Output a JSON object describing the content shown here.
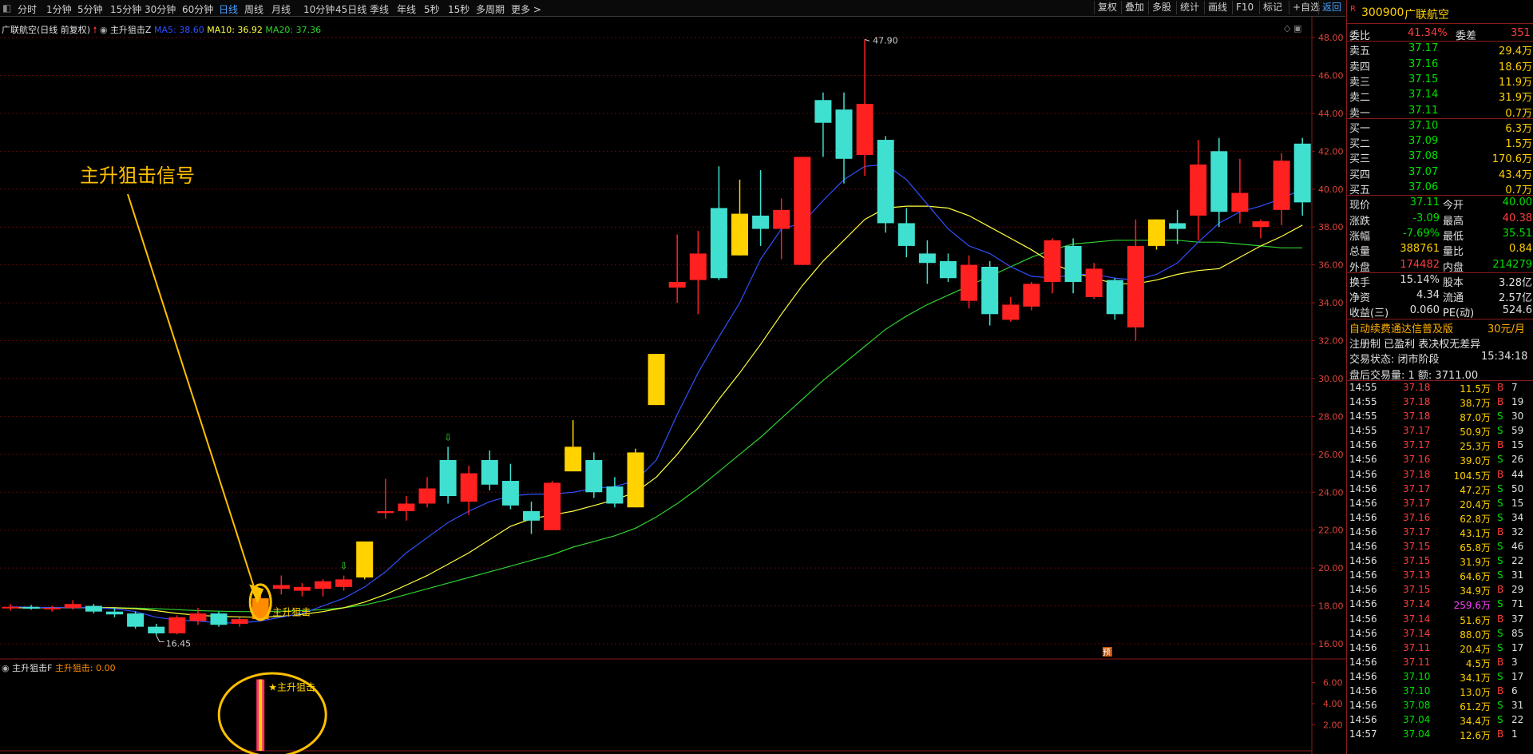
{
  "timeframes": [
    "分时",
    "1分钟",
    "5分钟",
    "15分钟",
    "30分钟",
    "60分钟",
    "日线",
    "周线",
    "月线",
    "10分钟",
    "45日线",
    "季线",
    "年线",
    "5秒",
    "15秒",
    "多周期",
    "更多 >"
  ],
  "active_timeframe": "日线",
  "toolbar_buttons": [
    "复权",
    "叠加",
    "多股",
    "统计",
    "画线",
    "F10",
    "标记",
    "+自选",
    "返回"
  ],
  "chart_header": {
    "stock_label": "广联航空(日线 前复权)",
    "indicator_name": "主升狙击Z",
    "ma5": "MA5: 38.60",
    "ma10": "MA10: 36.92",
    "ma20": "MA20: 37.36"
  },
  "annotation_text": "主升狙击信号",
  "signal_label": "主升狙击",
  "high_label": "47.90",
  "low_label": "16.45",
  "pre_marker": "预",
  "sub_header": {
    "name": "主升狙击F",
    "value": "主升狙击: 0.00"
  },
  "sub_signal_label": "主升狙击",
  "y_axis_main": [
    "48.00",
    "46.00",
    "44.00",
    "42.00",
    "40.00",
    "38.00",
    "36.00",
    "34.00",
    "32.00",
    "30.00",
    "28.00",
    "26.00",
    "24.00",
    "22.00",
    "20.00",
    "18.00",
    "16.00"
  ],
  "y_axis_sub": [
    "6.00",
    "4.00",
    "2.00"
  ],
  "colors": {
    "up": "#ff2020",
    "down": "#40e0d0",
    "limit_up": "#ffd200",
    "signal": "#ff8c00",
    "ma5": "#3050ff",
    "ma10": "#ffff40",
    "ma20": "#30d030"
  },
  "chart_data": {
    "type": "candlestick",
    "ylim": [
      15,
      48.5
    ],
    "candles": [
      {
        "o": 17.9,
        "h": 18.1,
        "l": 17.75,
        "c": 17.95
      },
      {
        "o": 17.95,
        "h": 18.05,
        "l": 17.8,
        "c": 17.85
      },
      {
        "o": 17.85,
        "h": 18.0,
        "l": 17.7,
        "c": 17.9
      },
      {
        "o": 17.9,
        "h": 18.3,
        "l": 17.8,
        "c": 18.1
      },
      {
        "o": 18.0,
        "h": 18.1,
        "l": 17.6,
        "c": 17.7
      },
      {
        "o": 17.7,
        "h": 17.9,
        "l": 17.4,
        "c": 17.55
      },
      {
        "o": 17.6,
        "h": 17.7,
        "l": 16.8,
        "c": 16.9
      },
      {
        "o": 16.9,
        "h": 17.05,
        "l": 16.45,
        "c": 16.55
      },
      {
        "o": 16.55,
        "h": 17.5,
        "l": 16.5,
        "c": 17.4
      },
      {
        "o": 17.2,
        "h": 17.9,
        "l": 17.0,
        "c": 17.6
      },
      {
        "o": 17.6,
        "h": 17.7,
        "l": 16.9,
        "c": 17.0
      },
      {
        "o": 17.05,
        "h": 17.4,
        "l": 16.9,
        "c": 17.3
      },
      {
        "o": 17.3,
        "h": 18.6,
        "l": 17.2,
        "c": 18.4
      },
      {
        "o": 18.9,
        "h": 19.6,
        "l": 18.6,
        "c": 19.1
      },
      {
        "o": 18.8,
        "h": 19.2,
        "l": 18.5,
        "c": 19.0
      },
      {
        "o": 18.9,
        "h": 19.4,
        "l": 18.5,
        "c": 19.3
      },
      {
        "o": 19.0,
        "h": 19.6,
        "l": 18.8,
        "c": 19.4
      },
      {
        "o": 19.5,
        "h": 21.4,
        "l": 19.4,
        "c": 21.4
      },
      {
        "o": 22.9,
        "h": 24.7,
        "l": 22.6,
        "c": 23.0
      },
      {
        "o": 23.0,
        "h": 23.8,
        "l": 22.5,
        "c": 23.4
      },
      {
        "o": 23.4,
        "h": 24.8,
        "l": 23.2,
        "c": 24.2
      },
      {
        "o": 25.7,
        "h": 26.4,
        "l": 23.4,
        "c": 23.8
      },
      {
        "o": 23.5,
        "h": 25.4,
        "l": 22.8,
        "c": 25.0
      },
      {
        "o": 25.7,
        "h": 26.2,
        "l": 24.1,
        "c": 24.4
      },
      {
        "o": 24.6,
        "h": 25.5,
        "l": 23.1,
        "c": 23.3
      },
      {
        "o": 23.0,
        "h": 23.5,
        "l": 21.8,
        "c": 22.5
      },
      {
        "o": 22.0,
        "h": 24.6,
        "l": 22.0,
        "c": 24.5
      },
      {
        "o": 25.1,
        "h": 27.8,
        "l": 25.1,
        "c": 26.4
      },
      {
        "o": 25.7,
        "h": 26.1,
        "l": 23.7,
        "c": 24.0
      },
      {
        "o": 24.3,
        "h": 24.8,
        "l": 23.2,
        "c": 23.4
      },
      {
        "o": 23.2,
        "h": 26.3,
        "l": 23.2,
        "c": 26.1
      },
      {
        "o": 28.6,
        "h": 31.3,
        "l": 28.6,
        "c": 31.3
      },
      {
        "o": 34.8,
        "h": 37.6,
        "l": 34.0,
        "c": 35.1
      },
      {
        "o": 35.2,
        "h": 37.8,
        "l": 33.4,
        "c": 36.6
      },
      {
        "o": 39.0,
        "h": 41.2,
        "l": 35.2,
        "c": 35.3
      },
      {
        "o": 36.5,
        "h": 40.5,
        "l": 36.5,
        "c": 38.7
      },
      {
        "o": 38.6,
        "h": 41.0,
        "l": 37.0,
        "c": 37.9
      },
      {
        "o": 37.9,
        "h": 39.5,
        "l": 36.3,
        "c": 38.9
      },
      {
        "o": 36.0,
        "h": 41.7,
        "l": 36.0,
        "c": 41.7
      },
      {
        "o": 44.7,
        "h": 45.1,
        "l": 41.7,
        "c": 43.5
      },
      {
        "o": 44.2,
        "h": 45.1,
        "l": 40.3,
        "c": 41.6
      },
      {
        "o": 41.8,
        "h": 47.9,
        "l": 40.7,
        "c": 44.5
      },
      {
        "o": 42.6,
        "h": 42.8,
        "l": 37.7,
        "c": 38.2
      },
      {
        "o": 38.2,
        "h": 39.0,
        "l": 36.4,
        "c": 37.0
      },
      {
        "o": 36.6,
        "h": 37.3,
        "l": 35.0,
        "c": 36.1
      },
      {
        "o": 36.2,
        "h": 36.6,
        "l": 35.1,
        "c": 35.3
      },
      {
        "o": 34.1,
        "h": 36.5,
        "l": 33.7,
        "c": 36.0
      },
      {
        "o": 35.9,
        "h": 36.2,
        "l": 32.8,
        "c": 33.4
      },
      {
        "o": 33.1,
        "h": 34.3,
        "l": 33.0,
        "c": 33.9
      },
      {
        "o": 33.8,
        "h": 35.1,
        "l": 33.6,
        "c": 35.0
      },
      {
        "o": 35.1,
        "h": 37.4,
        "l": 34.5,
        "c": 37.3
      },
      {
        "o": 37.0,
        "h": 37.4,
        "l": 34.5,
        "c": 35.1
      },
      {
        "o": 34.3,
        "h": 36.1,
        "l": 34.2,
        "c": 35.8
      },
      {
        "o": 35.2,
        "h": 35.3,
        "l": 33.1,
        "c": 33.4
      },
      {
        "o": 32.7,
        "h": 38.4,
        "l": 32.0,
        "c": 37.0
      },
      {
        "o": 37.0,
        "h": 38.4,
        "l": 36.8,
        "c": 38.4
      },
      {
        "o": 38.2,
        "h": 38.9,
        "l": 37.1,
        "c": 37.9
      },
      {
        "o": 38.6,
        "h": 42.6,
        "l": 37.3,
        "c": 41.3
      },
      {
        "o": 42.0,
        "h": 42.7,
        "l": 38.0,
        "c": 38.8
      },
      {
        "o": 38.8,
        "h": 41.6,
        "l": 38.2,
        "c": 39.8
      },
      {
        "o": 38.0,
        "h": 38.4,
        "l": 37.4,
        "c": 38.3
      },
      {
        "o": 38.9,
        "h": 41.9,
        "l": 38.1,
        "c": 41.5
      },
      {
        "o": 42.4,
        "h": 42.7,
        "l": 38.6,
        "c": 39.3
      }
    ],
    "limit_up_indices": [
      17,
      27,
      30,
      31,
      35,
      55
    ],
    "signal_index": 12,
    "arrow_indices": [
      16,
      21
    ],
    "ma5": [
      17.95,
      17.93,
      17.9,
      17.92,
      17.9,
      17.85,
      17.7,
      17.4,
      17.25,
      17.2,
      17.1,
      17.1,
      17.2,
      17.4,
      17.6,
      18.0,
      18.4,
      19.0,
      19.8,
      20.8,
      21.6,
      22.4,
      23.0,
      23.5,
      23.8,
      23.9,
      23.9,
      24.0,
      24.2,
      24.3,
      24.6,
      25.7,
      28.1,
      30.3,
      32.2,
      34.0,
      36.3,
      37.9,
      38.2,
      39.4,
      40.5,
      41.2,
      41.3,
      40.5,
      39.2,
      37.9,
      37.0,
      36.6,
      35.9,
      35.4,
      35.3,
      35.5,
      35.5,
      35.3,
      35.2,
      35.5,
      36.1,
      37.2,
      38.2,
      38.8,
      39.1,
      39.5,
      40.0
    ],
    "ma10": [
      17.9,
      17.9,
      17.9,
      17.9,
      17.9,
      17.9,
      17.85,
      17.75,
      17.6,
      17.5,
      17.45,
      17.42,
      17.4,
      17.45,
      17.55,
      17.7,
      17.9,
      18.2,
      18.6,
      19.1,
      19.6,
      20.2,
      20.8,
      21.5,
      22.2,
      22.6,
      22.8,
      23.0,
      23.3,
      23.6,
      24.0,
      24.8,
      26.0,
      27.4,
      28.9,
      30.3,
      31.8,
      33.4,
      34.9,
      36.2,
      37.3,
      38.4,
      39.0,
      39.1,
      39.1,
      39.0,
      38.6,
      38.0,
      37.4,
      36.8,
      36.1,
      35.6,
      35.3,
      35.0,
      35.0,
      35.2,
      35.5,
      35.7,
      35.8,
      36.4,
      37.0,
      37.5,
      38.1
    ],
    "ma20": [
      17.9,
      17.9,
      17.9,
      17.9,
      17.9,
      17.9,
      17.88,
      17.85,
      17.8,
      17.75,
      17.72,
      17.7,
      17.7,
      17.72,
      17.75,
      17.8,
      17.9,
      18.05,
      18.3,
      18.6,
      18.9,
      19.2,
      19.5,
      19.8,
      20.1,
      20.4,
      20.7,
      21.1,
      21.4,
      21.7,
      22.1,
      22.7,
      23.4,
      24.2,
      25.1,
      26.0,
      26.9,
      27.9,
      28.9,
      29.9,
      30.8,
      31.7,
      32.6,
      33.3,
      33.9,
      34.4,
      34.9,
      35.4,
      35.9,
      36.4,
      36.8,
      37.1,
      37.2,
      37.3,
      37.3,
      37.3,
      37.3,
      37.2,
      37.2,
      37.1,
      37.0,
      36.9,
      36.9
    ],
    "sub_chart": {
      "ylim": [
        0,
        8
      ],
      "signal_bar_value": 6.3
    }
  },
  "quote": {
    "code": "300900",
    "name": "广联航空",
    "rows_top": [
      {
        "label": "委比",
        "value": "41.34%",
        "label2": "委差",
        "value2": "351"
      }
    ],
    "asks": [
      {
        "label": "卖五",
        "price": "37.17",
        "vol": "29.4万"
      },
      {
        "label": "卖四",
        "price": "37.16",
        "vol": "18.6万"
      },
      {
        "label": "卖三",
        "price": "37.15",
        "vol": "11.9万"
      },
      {
        "label": "卖二",
        "price": "37.14",
        "vol": "31.9万"
      },
      {
        "label": "卖一",
        "price": "37.11",
        "vol": "0.7万"
      }
    ],
    "bids": [
      {
        "label": "买一",
        "price": "37.10",
        "vol": "6.3万"
      },
      {
        "label": "买二",
        "price": "37.09",
        "vol": "1.5万"
      },
      {
        "label": "买三",
        "price": "37.08",
        "vol": "170.6万"
      },
      {
        "label": "买四",
        "price": "37.07",
        "vol": "43.4万"
      },
      {
        "label": "买五",
        "price": "37.06",
        "vol": "0.7万"
      }
    ],
    "stats": [
      {
        "l1": "现价",
        "v1": "37.11",
        "l2": "今开",
        "v2": "40.00"
      },
      {
        "l1": "涨跌",
        "v1": "-3.09",
        "l2": "最高",
        "v2": "40.38"
      },
      {
        "l1": "涨幅",
        "v1": "-7.69%",
        "l2": "最低",
        "v2": "35.51"
      },
      {
        "l1": "总量",
        "v1": "388761",
        "l2": "量比",
        "v2": "0.84"
      },
      {
        "l1": "外盘",
        "v1": "174482",
        "l2": "内盘",
        "v2": "214279"
      }
    ],
    "fund": [
      {
        "l1": "换手",
        "v1": "15.14%",
        "l2": "股本",
        "v2": "3.28亿"
      },
      {
        "l1": "净资",
        "v1": "4.34",
        "l2": "流通",
        "v2": "2.57亿"
      },
      {
        "l1": "收益(三)",
        "v1": "0.060",
        "l2": "PE(动)",
        "v2": "524.6"
      }
    ],
    "promo1": "自动续费通达信普及版",
    "promo1_price": "30元/月",
    "promo2": "注册制 已盈利 表决权无差异",
    "status_label": "交易状态: 闭市阶段",
    "status_time": "15:34:18",
    "after_hours": "盘后交易量: 1  额: 3711.00"
  },
  "ticks": [
    {
      "t": "14:55",
      "p": "37.18",
      "v": "11.5万",
      "s": "B",
      "n": "7"
    },
    {
      "t": "14:55",
      "p": "37.18",
      "v": "38.7万",
      "s": "B",
      "n": "19"
    },
    {
      "t": "14:55",
      "p": "37.18",
      "v": "87.0万",
      "s": "S",
      "n": "30"
    },
    {
      "t": "14:55",
      "p": "37.17",
      "v": "50.9万",
      "s": "S",
      "n": "59"
    },
    {
      "t": "14:56",
      "p": "37.17",
      "v": "25.3万",
      "s": "B",
      "n": "15"
    },
    {
      "t": "14:56",
      "p": "37.16",
      "v": "39.0万",
      "s": "S",
      "n": "26"
    },
    {
      "t": "14:56",
      "p": "37.18",
      "v": "104.5万",
      "s": "B",
      "n": "44"
    },
    {
      "t": "14:56",
      "p": "37.17",
      "v": "47.2万",
      "s": "S",
      "n": "50"
    },
    {
      "t": "14:56",
      "p": "37.17",
      "v": "20.4万",
      "s": "S",
      "n": "15"
    },
    {
      "t": "14:56",
      "p": "37.16",
      "v": "62.8万",
      "s": "S",
      "n": "34"
    },
    {
      "t": "14:56",
      "p": "37.17",
      "v": "43.1万",
      "s": "B",
      "n": "32"
    },
    {
      "t": "14:56",
      "p": "37.15",
      "v": "65.8万",
      "s": "S",
      "n": "46"
    },
    {
      "t": "14:56",
      "p": "37.15",
      "v": "31.9万",
      "s": "S",
      "n": "22"
    },
    {
      "t": "14:56",
      "p": "37.13",
      "v": "64.6万",
      "s": "S",
      "n": "31"
    },
    {
      "t": "14:56",
      "p": "37.15",
      "v": "34.9万",
      "s": "B",
      "n": "29"
    },
    {
      "t": "14:56",
      "p": "37.14",
      "v": "259.6万",
      "s": "S",
      "n": "71",
      "big": true
    },
    {
      "t": "14:56",
      "p": "37.14",
      "v": "51.6万",
      "s": "B",
      "n": "37"
    },
    {
      "t": "14:56",
      "p": "37.14",
      "v": "88.0万",
      "s": "S",
      "n": "85"
    },
    {
      "t": "14:56",
      "p": "37.11",
      "v": "20.4万",
      "s": "S",
      "n": "17"
    },
    {
      "t": "14:56",
      "p": "37.11",
      "v": "4.5万",
      "s": "B",
      "n": "3"
    },
    {
      "t": "14:56",
      "p": "37.10",
      "v": "34.1万",
      "s": "S",
      "n": "17"
    },
    {
      "t": "14:56",
      "p": "37.10",
      "v": "13.0万",
      "s": "B",
      "n": "6"
    },
    {
      "t": "14:56",
      "p": "37.08",
      "v": "61.2万",
      "s": "S",
      "n": "31"
    },
    {
      "t": "14:56",
      "p": "37.04",
      "v": "34.4万",
      "s": "S",
      "n": "22"
    },
    {
      "t": "14:57",
      "p": "37.04",
      "v": "12.6万",
      "s": "B",
      "n": "1"
    }
  ]
}
